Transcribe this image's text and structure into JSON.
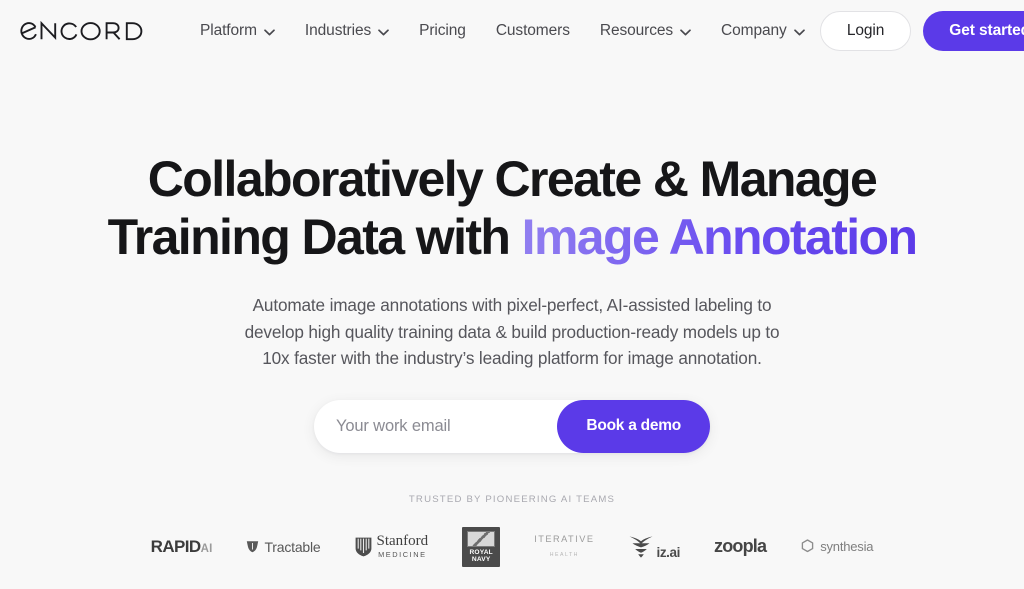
{
  "header": {
    "logo_text": "ENCORD",
    "nav": [
      {
        "label": "Platform",
        "has_dropdown": true,
        "icon": "chevron-down-icon"
      },
      {
        "label": "Industries",
        "has_dropdown": true,
        "icon": "chevron-down-icon"
      },
      {
        "label": "Pricing",
        "has_dropdown": false,
        "icon": ""
      },
      {
        "label": "Customers",
        "has_dropdown": false,
        "icon": ""
      },
      {
        "label": "Resources",
        "has_dropdown": true,
        "icon": "chevron-down-icon"
      },
      {
        "label": "Company",
        "has_dropdown": true,
        "icon": "chevron-down-icon"
      }
    ],
    "login_label": "Login",
    "get_started_label": "Get started"
  },
  "hero": {
    "headline_line1": "Collaboratively Create & Manage",
    "headline_line2_plain": "Training Data with ",
    "headline_line2_accent": "Image Annotation",
    "subhead_line1": "Automate image annotations with pixel-perfect, AI-assisted labeling to",
    "subhead_line2": "develop high quality training data & build production-ready models up to",
    "subhead_line3": "10x faster with the industry’s leading platform for image annotation."
  },
  "form": {
    "email_placeholder": "Your work email",
    "email_value": "",
    "submit_label": "Book a demo"
  },
  "trust": {
    "label": "TRUSTED BY PIONEERING AI TEAMS",
    "brands": [
      {
        "name": "RapidAI",
        "text": "RAPID",
        "suffix": "AI",
        "icon": ""
      },
      {
        "name": "Tractable",
        "text": "Tractable",
        "suffix": "",
        "icon": "tractable-shield-icon"
      },
      {
        "name": "Stanford Medicine",
        "text": "Stanford",
        "suffix": "MEDICINE",
        "icon": "stanford-shield-icon"
      },
      {
        "name": "The Royal Navy",
        "text": "ROYAL",
        "suffix": "NAVY",
        "icon": "royal-navy-crest-icon"
      },
      {
        "name": "Iterative Health",
        "text": "ITERATIVE",
        "suffix": "HEALTH",
        "icon": ""
      },
      {
        "name": "iz.ai",
        "text": "iz.ai",
        "suffix": "",
        "icon": "iz-ai-mark-icon"
      },
      {
        "name": "Zoopla",
        "text": "zoopla",
        "suffix": "",
        "icon": ""
      },
      {
        "name": "Synthesia",
        "text": "synthesia",
        "suffix": "",
        "icon": "synthesia-hex-icon"
      }
    ]
  },
  "colors": {
    "accent_purple": "#5b3ae8",
    "accent_purple_light": "#9280f0",
    "page_background": "#f8f8f8",
    "heading": "#161618",
    "body_text": "#56565c"
  }
}
